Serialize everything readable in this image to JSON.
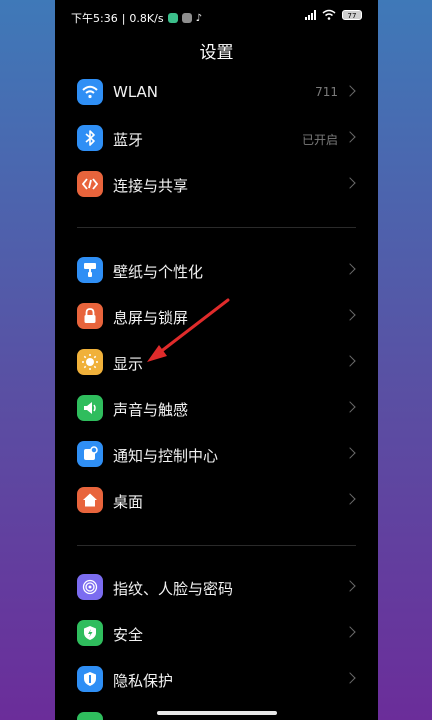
{
  "status_bar": {
    "time": "下午5:36",
    "separator": "|",
    "speed": "0.8K/s",
    "battery": "77",
    "colors": {
      "app1": "#3cbf8b",
      "app2": "#8e8e8e"
    }
  },
  "header": {
    "title": "设置"
  },
  "groups": [
    {
      "items": [
        {
          "label": "WLAN",
          "value": "711",
          "icon": "wifi-icon",
          "color": "#2f8ff5"
        },
        {
          "label": "蓝牙",
          "value": "已开启",
          "icon": "bluetooth-icon",
          "color": "#2f8ff5"
        },
        {
          "label": "连接与共享",
          "value": "",
          "icon": "connection-share-icon",
          "color": "#e8643c"
        }
      ]
    },
    {
      "items": [
        {
          "label": "壁纸与个性化",
          "value": "",
          "icon": "paint-roller-icon",
          "color": "#2f8ff5"
        },
        {
          "label": "息屏与锁屏",
          "value": "",
          "icon": "lock-icon",
          "color": "#e8643c"
        },
        {
          "label": "显示",
          "value": "",
          "icon": "brightness-sun-icon",
          "color": "#f0b13a"
        },
        {
          "label": "声音与触感",
          "value": "",
          "icon": "speaker-icon",
          "color": "#2fbd5d"
        },
        {
          "label": "通知与控制中心",
          "value": "",
          "icon": "notification-icon",
          "color": "#2f8ff5"
        },
        {
          "label": "桌面",
          "value": "",
          "icon": "home-icon",
          "color": "#e8643c"
        }
      ]
    },
    {
      "items": [
        {
          "label": "指纹、人脸与密码",
          "value": "",
          "icon": "fingerprint-icon",
          "color": "#7b6cf0"
        },
        {
          "label": "安全",
          "value": "",
          "icon": "security-shield-icon",
          "color": "#2fbd5d"
        },
        {
          "label": "隐私保护",
          "value": "",
          "icon": "privacy-icon",
          "color": "#2f8ff5"
        }
      ]
    }
  ],
  "annotation": {
    "color": "#e02b2b"
  }
}
